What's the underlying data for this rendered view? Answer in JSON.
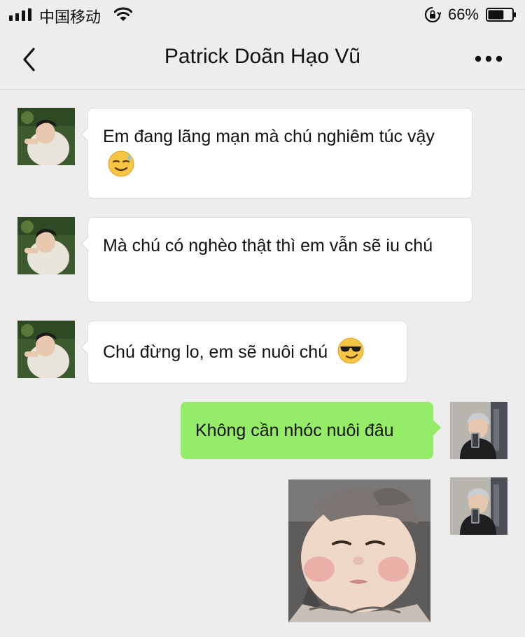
{
  "status_bar": {
    "carrier": "中国移动",
    "battery_percent": "66%",
    "battery_level": 0.66
  },
  "nav": {
    "title": "Patrick Doãn Hạo Vũ"
  },
  "messages": [
    {
      "side": "in",
      "text": "Em đang lãng mạn mà chú nghiêm túc vậy",
      "emoji": "sweat-smile-face"
    },
    {
      "side": "in",
      "text": "Mà chú có nghèo thật thì em vẫn sẽ iu chú"
    },
    {
      "side": "in",
      "text": "Chú đừng lo, em sẽ nuôi chú",
      "emoji": "sunglasses-face"
    },
    {
      "side": "out",
      "text": "Không cần nhóc nuôi đâu"
    },
    {
      "side": "out",
      "type": "sticker",
      "sticker": "baby-face-sticker"
    }
  ],
  "colors": {
    "background": "#ededed",
    "incoming_bubble": "#ffffff",
    "outgoing_bubble": "#95ec69"
  }
}
